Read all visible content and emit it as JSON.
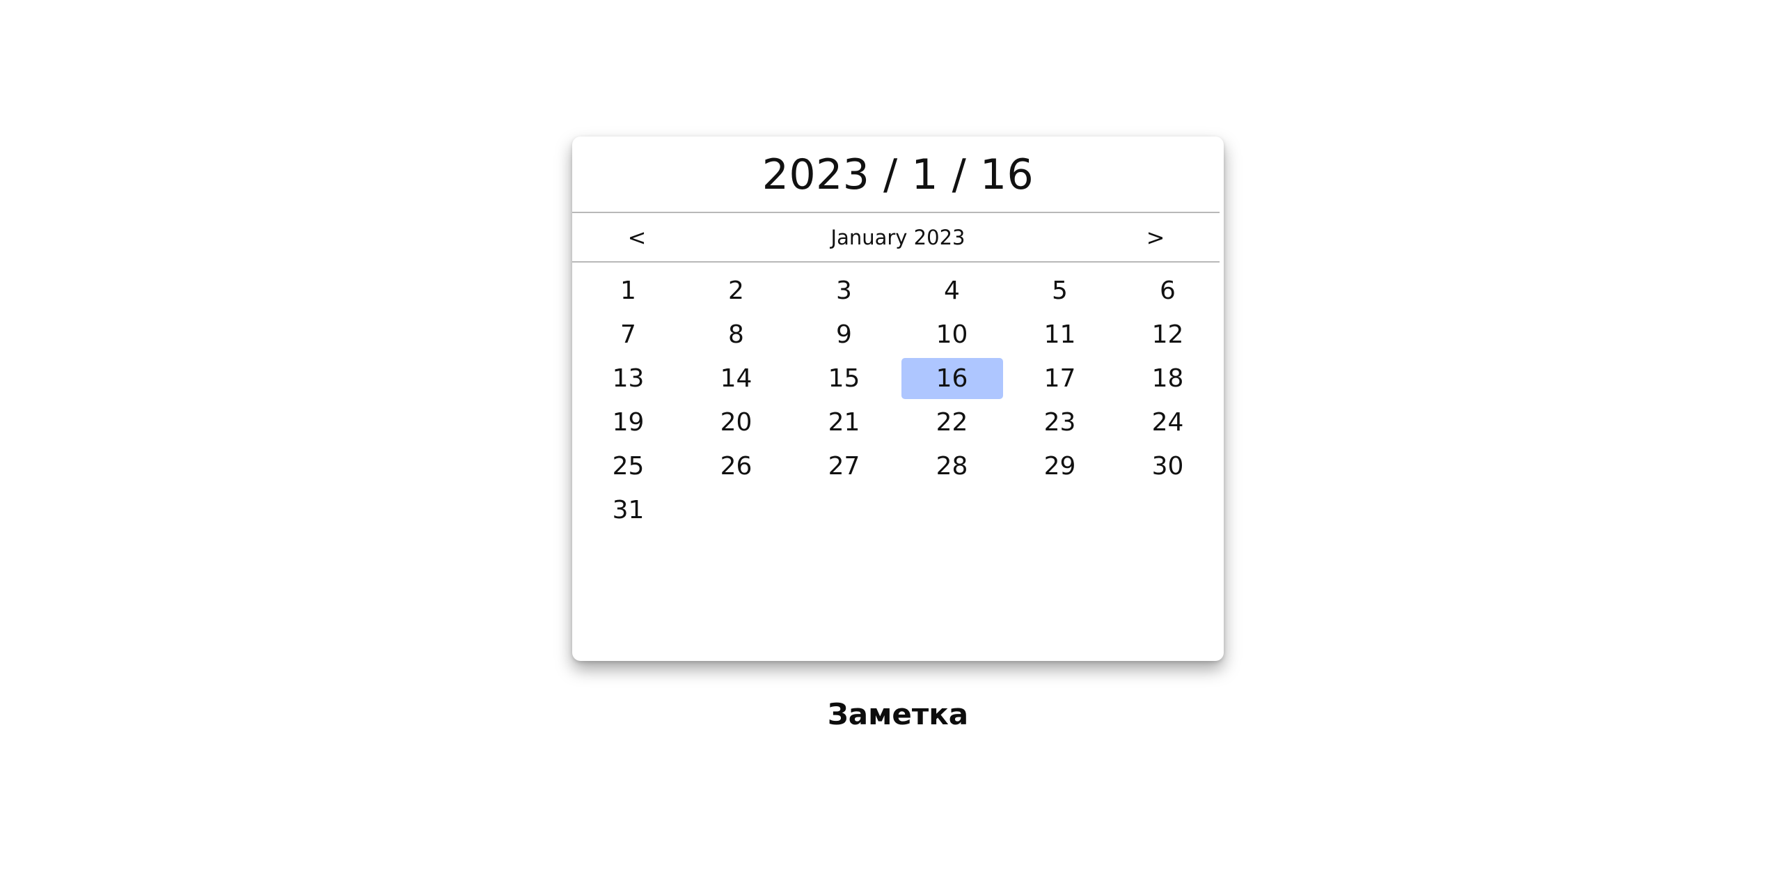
{
  "calendar": {
    "selected_date": "2023 / 1 / 16",
    "prev_label": "<",
    "next_label": ">",
    "month_label": "January 2023",
    "selected_day": 16,
    "days": [
      "1",
      "2",
      "3",
      "4",
      "5",
      "6",
      "7",
      "8",
      "9",
      "10",
      "11",
      "12",
      "13",
      "14",
      "15",
      "16",
      "17",
      "18",
      "19",
      "20",
      "21",
      "22",
      "23",
      "24",
      "25",
      "26",
      "27",
      "28",
      "29",
      "30",
      "31"
    ]
  },
  "note": {
    "label": "Заметка"
  },
  "colors": {
    "selected_day_bg": "#aec6ff",
    "divider": "#b8b8b8"
  }
}
